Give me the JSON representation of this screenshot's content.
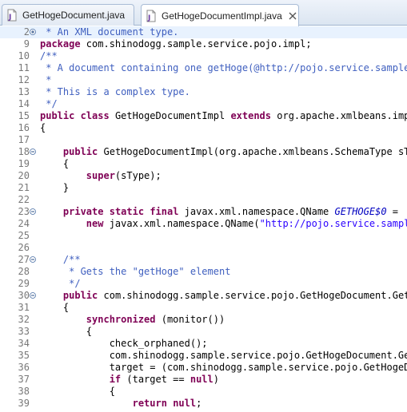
{
  "tabs": [
    {
      "label": "GetHogeDocument.java",
      "active": false
    },
    {
      "label": "GetHogeDocumentImpl.java",
      "active": true
    }
  ],
  "editor": {
    "lines": [
      {
        "num": "2",
        "fold": "expand",
        "highlight": true,
        "tokens": [
          {
            "t": " * An XML document type.",
            "c": "cm"
          }
        ]
      },
      {
        "num": "9",
        "tokens": [
          {
            "t": "package",
            "c": "kw"
          },
          {
            "t": " com.shinodogg.sample.service.pojo.impl;",
            "c": ""
          }
        ]
      },
      {
        "num": "10",
        "tokens": [
          {
            "t": "/**",
            "c": "cm"
          }
        ]
      },
      {
        "num": "11",
        "tokens": [
          {
            "t": " * A document containing one getHoge(@http://pojo.service.sample.s",
            "c": "cm"
          }
        ]
      },
      {
        "num": "12",
        "tokens": [
          {
            "t": " *",
            "c": "cm"
          }
        ]
      },
      {
        "num": "13",
        "tokens": [
          {
            "t": " * This is a complex type.",
            "c": "cm"
          }
        ]
      },
      {
        "num": "14",
        "tokens": [
          {
            "t": " */",
            "c": "cm"
          }
        ]
      },
      {
        "num": "15",
        "tokens": [
          {
            "t": "public",
            "c": "kw"
          },
          {
            "t": " ",
            "c": ""
          },
          {
            "t": "class",
            "c": "kw"
          },
          {
            "t": " GetHogeDocumentImpl ",
            "c": ""
          },
          {
            "t": "extends",
            "c": "kw"
          },
          {
            "t": " org.apache.xmlbeans.impl.",
            "c": ""
          }
        ]
      },
      {
        "num": "16",
        "tokens": [
          {
            "t": "{",
            "c": ""
          }
        ]
      },
      {
        "num": "17",
        "tokens": []
      },
      {
        "num": "18",
        "fold": "collapse",
        "tokens": [
          {
            "t": "    ",
            "c": ""
          },
          {
            "t": "public",
            "c": "kw"
          },
          {
            "t": " GetHogeDocumentImpl(org.apache.xmlbeans.SchemaType sTyp",
            "c": ""
          }
        ]
      },
      {
        "num": "19",
        "tokens": [
          {
            "t": "    {",
            "c": ""
          }
        ]
      },
      {
        "num": "20",
        "tokens": [
          {
            "t": "        ",
            "c": ""
          },
          {
            "t": "super",
            "c": "kw"
          },
          {
            "t": "(sType);",
            "c": ""
          }
        ]
      },
      {
        "num": "21",
        "tokens": [
          {
            "t": "    }",
            "c": ""
          }
        ]
      },
      {
        "num": "22",
        "tokens": []
      },
      {
        "num": "23",
        "fold": "collapse",
        "tokens": [
          {
            "t": "    ",
            "c": ""
          },
          {
            "t": "private",
            "c": "kw"
          },
          {
            "t": " ",
            "c": ""
          },
          {
            "t": "static",
            "c": "kw"
          },
          {
            "t": " ",
            "c": ""
          },
          {
            "t": "final",
            "c": "kw"
          },
          {
            "t": " javax.xml.namespace.QName ",
            "c": ""
          },
          {
            "t": "GETHOGE$0",
            "c": "sf"
          },
          {
            "t": " =",
            "c": ""
          }
        ]
      },
      {
        "num": "24",
        "tokens": [
          {
            "t": "        ",
            "c": ""
          },
          {
            "t": "new",
            "c": "kw"
          },
          {
            "t": " javax.xml.namespace.QName(",
            "c": ""
          },
          {
            "t": "\"http://pojo.service.sample.",
            "c": "str"
          }
        ]
      },
      {
        "num": "25",
        "tokens": []
      },
      {
        "num": "26",
        "tokens": []
      },
      {
        "num": "27",
        "fold": "collapse",
        "tokens": [
          {
            "t": "    ",
            "c": ""
          },
          {
            "t": "/**",
            "c": "cm"
          }
        ]
      },
      {
        "num": "28",
        "tokens": [
          {
            "t": "     * Gets the \"getHoge\" element",
            "c": "cm"
          }
        ]
      },
      {
        "num": "29",
        "tokens": [
          {
            "t": "     */",
            "c": "cm"
          }
        ]
      },
      {
        "num": "30",
        "fold": "collapse",
        "tokens": [
          {
            "t": "    ",
            "c": ""
          },
          {
            "t": "public",
            "c": "kw"
          },
          {
            "t": " com.shinodogg.sample.service.pojo.GetHogeDocument.GetHo",
            "c": ""
          }
        ]
      },
      {
        "num": "31",
        "tokens": [
          {
            "t": "    {",
            "c": ""
          }
        ]
      },
      {
        "num": "32",
        "tokens": [
          {
            "t": "        ",
            "c": ""
          },
          {
            "t": "synchronized",
            "c": "kw"
          },
          {
            "t": " (monitor())",
            "c": ""
          }
        ]
      },
      {
        "num": "33",
        "tokens": [
          {
            "t": "        {",
            "c": ""
          }
        ]
      },
      {
        "num": "34",
        "tokens": [
          {
            "t": "            check_orphaned();",
            "c": ""
          }
        ]
      },
      {
        "num": "35",
        "tokens": [
          {
            "t": "            com.shinodogg.sample.service.pojo.GetHogeDocument.GetH",
            "c": ""
          }
        ]
      },
      {
        "num": "36",
        "tokens": [
          {
            "t": "            target = (com.shinodogg.sample.service.pojo.GetHogeDoc",
            "c": ""
          }
        ]
      },
      {
        "num": "37",
        "tokens": [
          {
            "t": "            ",
            "c": ""
          },
          {
            "t": "if",
            "c": "kw"
          },
          {
            "t": " (target == ",
            "c": ""
          },
          {
            "t": "null",
            "c": "kw"
          },
          {
            "t": ")",
            "c": ""
          }
        ]
      },
      {
        "num": "38",
        "tokens": [
          {
            "t": "            {",
            "c": ""
          }
        ]
      },
      {
        "num": "39",
        "tokens": [
          {
            "t": "                ",
            "c": ""
          },
          {
            "t": "return",
            "c": "kw"
          },
          {
            "t": " ",
            "c": ""
          },
          {
            "t": "null",
            "c": "kw"
          },
          {
            "t": ";",
            "c": ""
          }
        ]
      }
    ]
  }
}
